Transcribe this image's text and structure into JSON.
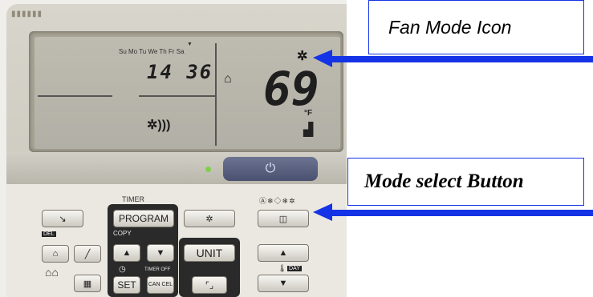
{
  "display": {
    "days": "Su Mo Tu We Th Fr Sa",
    "clock": "14 36",
    "temperature": "69",
    "unit": "°F"
  },
  "panel": {
    "timer_label": "TIMER",
    "program_label": "PROGRAM",
    "copy_label": "COPY",
    "del_label": "DEL",
    "unit_label": "UNIT",
    "set_label": "SET",
    "cancel_label": "CAN CEL",
    "timer_off_label": "TIMER OFF",
    "day_label": "DAY"
  },
  "callouts": {
    "fan_mode": "Fan Mode Icon",
    "mode_select": "Mode select Button"
  },
  "colors": {
    "callout_blue": "#1533e6"
  }
}
